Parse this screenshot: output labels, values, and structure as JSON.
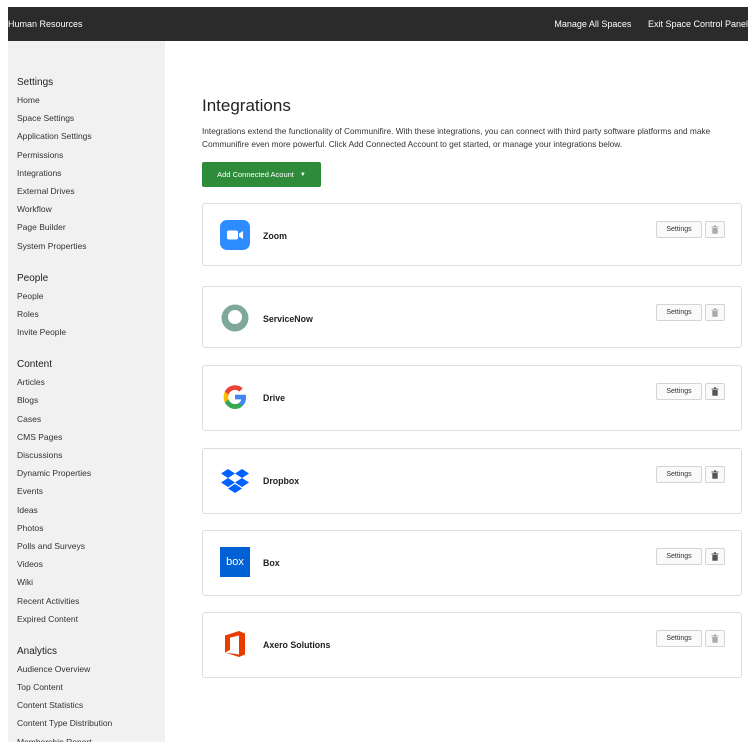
{
  "topbar": {
    "title": "Human Resources",
    "manage_all_spaces": "Manage All Spaces",
    "exit_panel": "Exit Space Control Panel"
  },
  "sidebar": {
    "sections": [
      {
        "title": "Settings",
        "items": [
          "Home",
          "Space Settings",
          "Application Settings",
          "Permissions",
          "Integrations",
          "External Drives",
          "Workflow",
          "Page Builder",
          "System Properties"
        ]
      },
      {
        "title": "People",
        "items": [
          "People",
          "Roles",
          "Invite People"
        ]
      },
      {
        "title": "Content",
        "items": [
          "Articles",
          "Blogs",
          "Cases",
          "CMS Pages",
          "Discussions",
          "Dynamic Properties",
          "Events",
          "Ideas",
          "Photos",
          "Polls and Surveys",
          "Videos",
          "Wiki",
          "Recent Activities",
          "Expired Content"
        ]
      },
      {
        "title": "Analytics",
        "items": [
          "Audience Overview",
          "Top Content",
          "Content Statistics",
          "Content Type Distribution",
          "Membership Report"
        ]
      }
    ]
  },
  "main": {
    "title": "Integrations",
    "description": "Integrations extend the functionality of Communifire. With these integrations, you can connect with third party software platforms and make Communifire even more powerful. Click Add Connected Account to get started, or manage your integrations below.",
    "add_button": "Add Connected Acount",
    "settings_label": "Settings"
  },
  "integrations": [
    {
      "name": "Zoom",
      "icon": "zoom-icon"
    },
    {
      "name": "ServiceNow",
      "icon": "servicenow-icon"
    },
    {
      "name": "Drive",
      "icon": "google-drive-icon"
    },
    {
      "name": "Dropbox",
      "icon": "dropbox-icon"
    },
    {
      "name": "Box",
      "icon": "box-icon",
      "logo_text": "box"
    },
    {
      "name": "Axero Solutions",
      "icon": "office-icon"
    }
  ],
  "colors": {
    "topbar": "#2b2b2b",
    "sidebar": "#f1f1f1",
    "accent_green": "#2e8b3a",
    "zoom_blue": "#2d8cff",
    "box_blue": "#0061d5",
    "office_orange": "#eb3c00",
    "dropbox_blue": "#0061fe"
  }
}
